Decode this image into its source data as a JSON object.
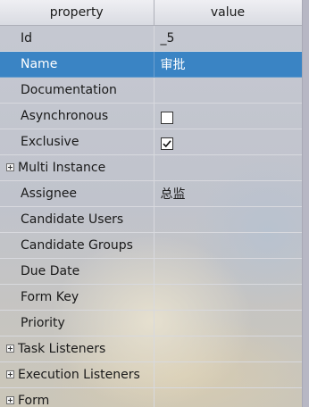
{
  "header": {
    "property": "property",
    "value": "value"
  },
  "rows": [
    {
      "key": "Id",
      "value": "_5"
    },
    {
      "key": "Name",
      "value": "审批",
      "selected": true
    },
    {
      "key": "Documentation",
      "value": ""
    },
    {
      "key": "Asynchronous",
      "checked": false
    },
    {
      "key": "Exclusive",
      "checked": true
    },
    {
      "key": "Multi Instance",
      "value": "",
      "expandable": true
    },
    {
      "key": "Assignee",
      "value": "总监"
    },
    {
      "key": "Candidate Users",
      "value": ""
    },
    {
      "key": "Candidate Groups",
      "value": ""
    },
    {
      "key": "Due Date",
      "value": ""
    },
    {
      "key": "Form Key",
      "value": ""
    },
    {
      "key": "Priority",
      "value": ""
    },
    {
      "key": "Task Listeners",
      "value": "",
      "expandable": true
    },
    {
      "key": "Execution Listeners",
      "value": "",
      "expandable": true
    },
    {
      "key": "Form",
      "value": "",
      "expandable": true
    }
  ],
  "colors": {
    "selection": "#3a84c4"
  }
}
